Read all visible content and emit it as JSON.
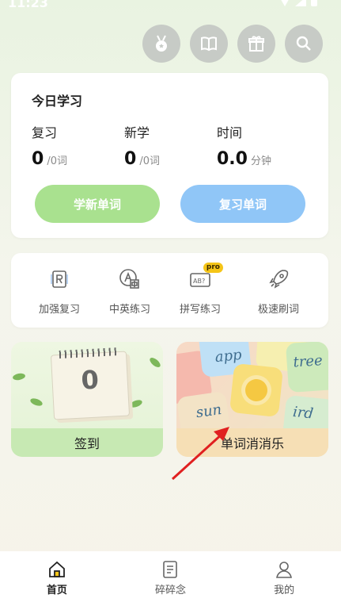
{
  "status_bar": {
    "time": "11:23"
  },
  "top_actions": {
    "icons": [
      "medal-icon",
      "book-icon",
      "gift-icon",
      "search-icon"
    ]
  },
  "today": {
    "title": "今日学习",
    "stats": [
      {
        "label": "复习",
        "value": "0",
        "unit": "/0词"
      },
      {
        "label": "新学",
        "value": "0",
        "unit": "/0词"
      },
      {
        "label": "时间",
        "value": "0.0",
        "unit": "分钟"
      }
    ],
    "learn_button": "学新单词",
    "review_button": "复习单词",
    "colors": {
      "learn": "#a9e18f",
      "review": "#90c6f7"
    }
  },
  "tools": [
    {
      "label": "加强复习",
      "icon": "review-r-icon"
    },
    {
      "label": "中英练习",
      "icon": "translate-icon"
    },
    {
      "label": "拼写练习",
      "icon": "spelling-icon",
      "badge": "pro"
    },
    {
      "label": "极速刷词",
      "icon": "rocket-icon"
    }
  ],
  "tiles": {
    "checkin": {
      "label": "签到",
      "count": "0"
    },
    "game": {
      "label": "单词消消乐",
      "words": [
        "app",
        "tree",
        "sun",
        "ird"
      ]
    }
  },
  "tab_bar": {
    "items": [
      {
        "label": "首页",
        "icon": "home-icon",
        "active": true
      },
      {
        "label": "碎碎念",
        "icon": "notes-icon",
        "active": false
      },
      {
        "label": "我的",
        "icon": "profile-icon",
        "active": false
      }
    ]
  }
}
